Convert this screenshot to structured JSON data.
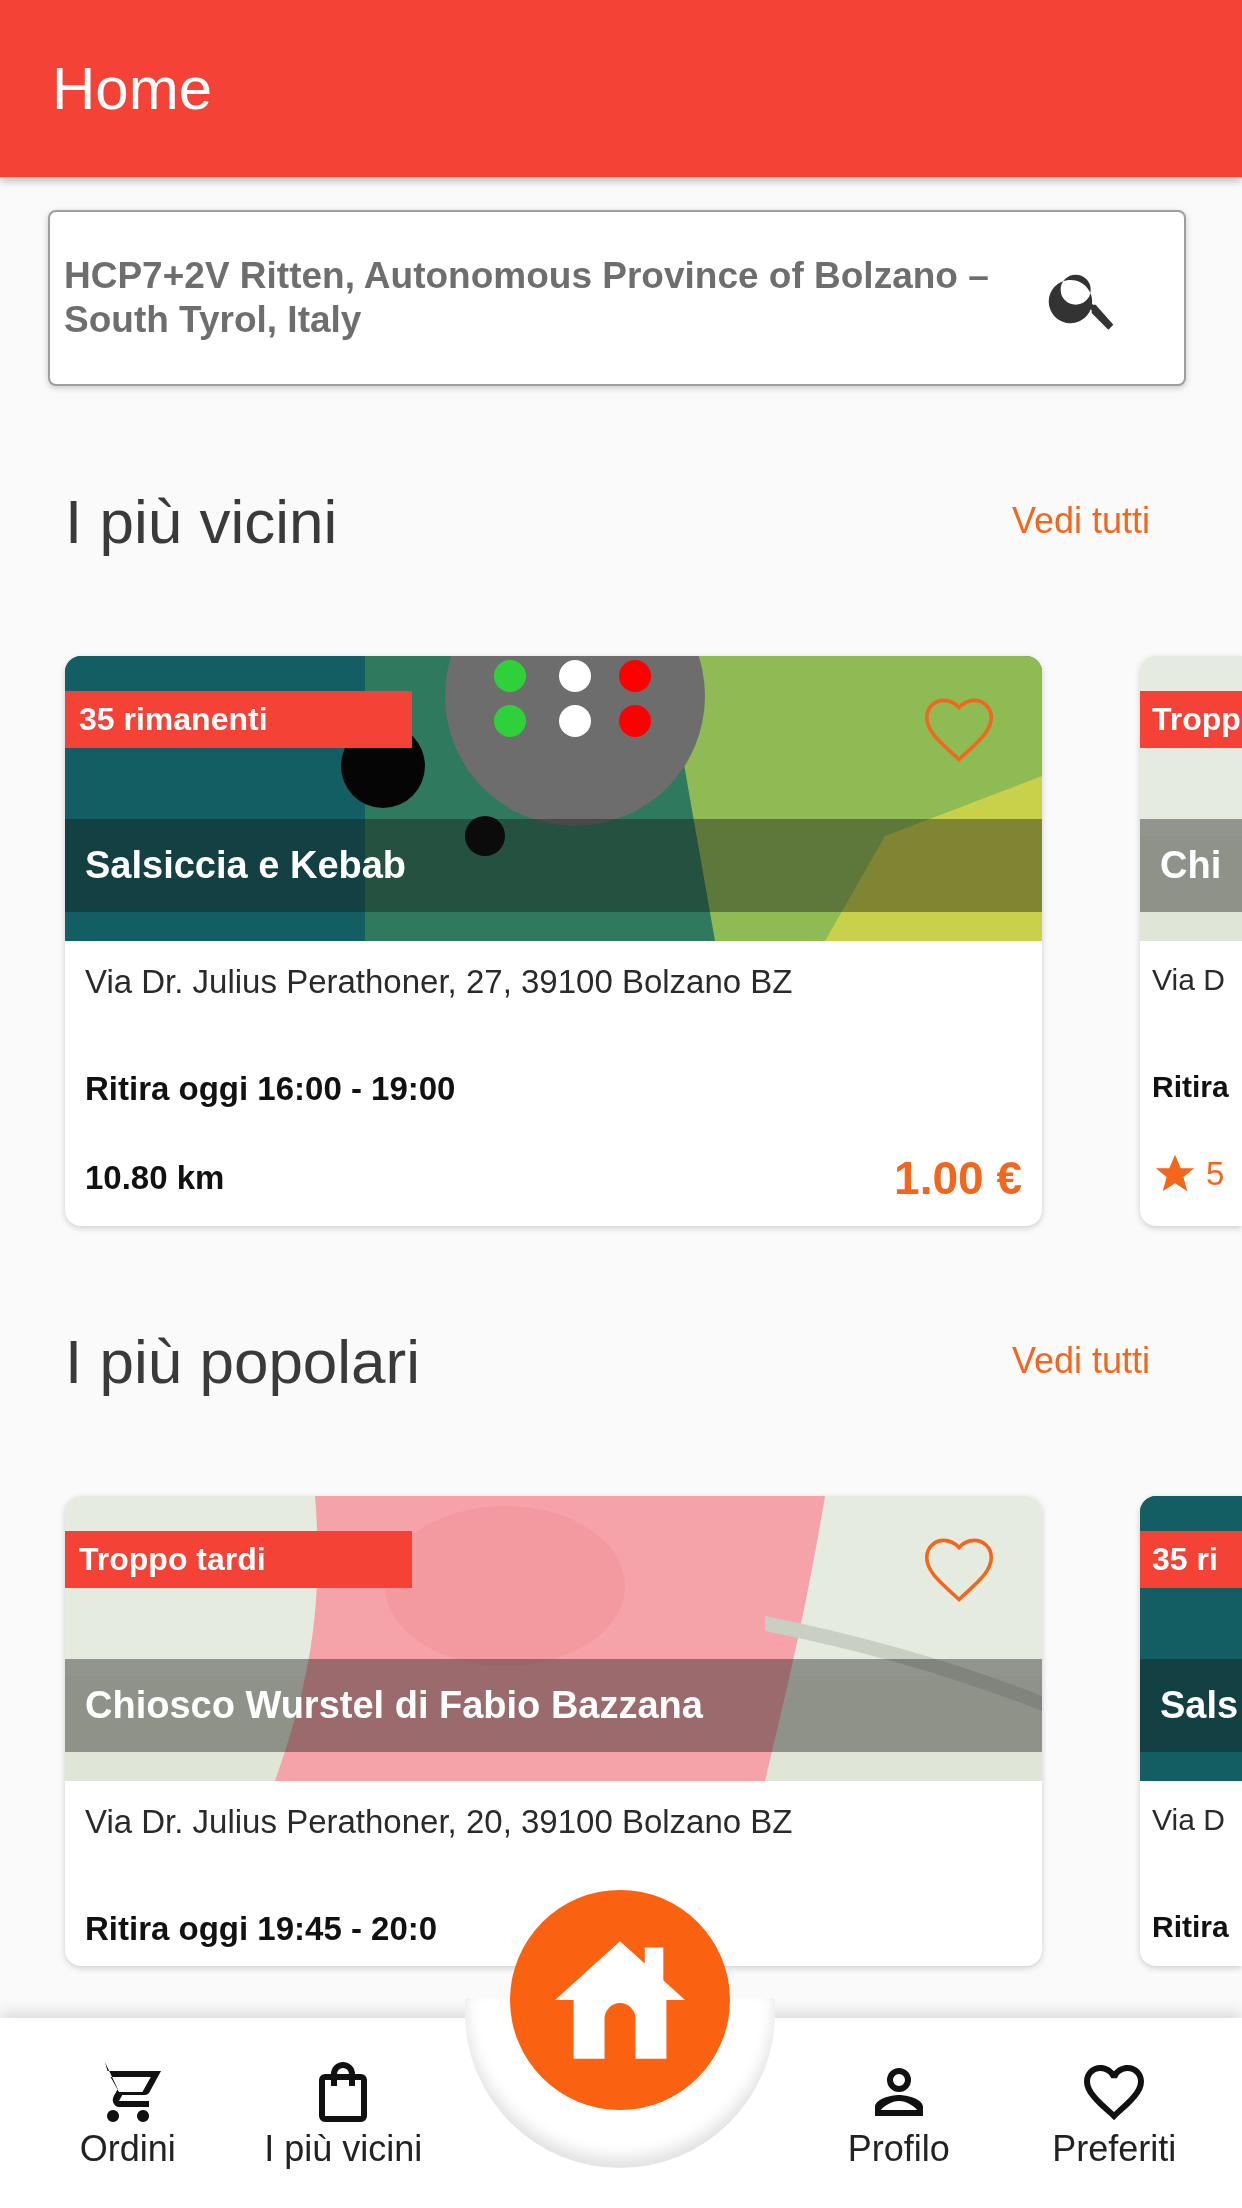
{
  "header": {
    "title": "Home"
  },
  "search": {
    "value": "HCP7+2V Ritten, Autonomous Province of Bolzano – South Tyrol, Italy"
  },
  "sections": [
    {
      "title": "I più vicini",
      "see_all": "Vedi tutti",
      "cards": [
        {
          "kind": "full",
          "badge": "35 rimanenti",
          "favorite": false,
          "name": "Salsiccia e Kebab",
          "address": "Via Dr. Julius Perathoner, 27, 39100 Bolzano BZ",
          "pickup": "Ritira oggi 16:00 - 19:00",
          "distance": "10.80 km",
          "price": "1.00 €"
        },
        {
          "kind": "peek",
          "badge": "Tropp",
          "name": "Chi",
          "address": "Via D",
          "pickup": "Ritira",
          "rating": "5"
        }
      ]
    },
    {
      "title": "I più popolari",
      "see_all": "Vedi tutti",
      "cards": [
        {
          "kind": "full",
          "badge": "Troppo tardi",
          "favorite": false,
          "name": "Chiosco Wurstel di Fabio Bazzana",
          "address": "Via Dr. Julius Perathoner, 20, 39100 Bolzano BZ",
          "pickup": "Ritira oggi 19:45 - 20:0"
        },
        {
          "kind": "peek",
          "badge": "35 ri",
          "name": "Sals",
          "address": "Via D",
          "pickup": "Ritira"
        }
      ]
    }
  ],
  "nav": {
    "items": [
      {
        "label": "Ordini"
      },
      {
        "label": "I più vicini"
      },
      {
        "label": "Profilo"
      },
      {
        "label": "Preferiti"
      }
    ]
  }
}
